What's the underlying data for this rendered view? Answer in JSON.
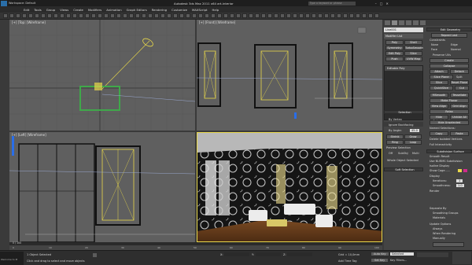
{
  "window": {
    "workspace": "Workspace: Default",
    "title": "Autodesk 3ds Max 2011 x64    art-interior",
    "search_placeholder": "Type a keyword or phrase"
  },
  "menu": [
    "Edit",
    "Tools",
    "Group",
    "Views",
    "Create",
    "Modifiers",
    "Animation",
    "Graph Editors",
    "Rendering",
    "Customize",
    "MAXScript",
    "Help"
  ],
  "viewports": {
    "top": "[+] [Top] [Wireframe]",
    "front": "[+] [Front] [Wireframe]",
    "left": "[+] [Left] [Wireframe]",
    "persp": "[+] [Perspective] [Realistic]"
  },
  "command_panel": {
    "object_name": "Line001",
    "modifier_list": "Modifier List",
    "left_buttons": [
      "Poly",
      "Shell",
      "Symmetry",
      "TurboSmooth",
      "Edit Poly",
      "Slice",
      "Push",
      "UVW Map"
    ],
    "stack_item": "Editable Poly",
    "right_top": "Edit Geometry",
    "repeat_last": "Repeat Last",
    "constraints": "Constraints",
    "constraint_options": [
      "None",
      "Edge",
      "Face",
      "Normal"
    ],
    "preserve_uvs": "Preserve UVs",
    "create": "Create",
    "collapse": "Collapse",
    "attach": "Attach",
    "detach": "Detach",
    "slice_plane": "Slice Plane",
    "split": "Split",
    "slice": "Slice",
    "reset_plane": "Reset Plane",
    "quickslice": "QuickSlice",
    "cut": "Cut",
    "msmooth": "MSmooth",
    "tessellate": "Tessellate",
    "make_planar": "Make Planar",
    "view_align": "View Align",
    "grid_align": "Grid Align",
    "relax": "Relax",
    "hide_selected": "Hide Selected",
    "unhide_all": "Unhide All",
    "hide_unselected": "Hide Unselected",
    "named_selections": "Named Selections:",
    "copy": "Copy",
    "paste": "Paste",
    "delete_isolated": "Delete Isolated Vertices",
    "full_interactivity": "Full Interactivity",
    "selection_title": "Selection",
    "by_vertex": "By Vertex",
    "ignore_backfacing": "Ignore Backfacing",
    "by_angle": "By Angle:",
    "by_angle_val": "45.0",
    "shrink": "Shrink",
    "grow": "Grow",
    "ring": "Ring",
    "loop": "Loop",
    "preview_selection": "Preview Selection",
    "preview_opts": [
      "Off",
      "SubObj",
      "Multi"
    ],
    "whole_object": "Whole Object Selected",
    "soft_selection": "Soft Selection",
    "subdivision_surface": "Subdivision Surface",
    "smooth_result": "Smooth Result",
    "use_nurms": "Use NURMS Subdivision",
    "isoline_display": "Isoline Display",
    "show_cage": "Show Cage......",
    "display": "Display",
    "iterations": "Iterations:",
    "iterations_val": "1",
    "smoothness": "Smoothness:",
    "smoothness_val": "1.0",
    "render": "Render",
    "separate_by": "Separate By",
    "smoothing_groups": "Smoothing Groups",
    "materials": "Materials",
    "update_options": "Update Options",
    "always": "Always",
    "when_rendering": "When Rendering",
    "manually": "Manually"
  },
  "timeline": {
    "frame": "0 / 100",
    "ticks": [
      "0",
      "10",
      "20",
      "30",
      "40",
      "50",
      "60",
      "70",
      "80",
      "90",
      "100"
    ]
  },
  "status": {
    "selected": "1 Object Selected",
    "hint": "Click and drag to select and move objects",
    "welcome": "Welcome to M",
    "x_label": "X:",
    "y_label": "Y:",
    "z_label": "Z:",
    "grid": "Grid = 10,0mm",
    "auto_key": "Auto Key",
    "set_key": "Set Key",
    "selected_dd": "Selected",
    "key_filters": "Key Filters...",
    "add_time_tag": "Add Time Tag"
  },
  "colors": {
    "accent_green": "#3fa84a",
    "wire_yellow": "#e8d84a",
    "viewport_bg": "#5f5f5f",
    "active_border": "#e8d84a"
  }
}
